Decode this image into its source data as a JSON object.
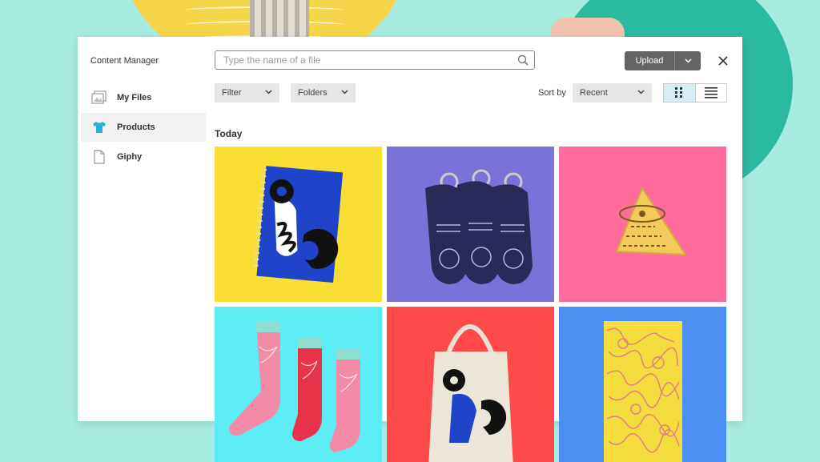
{
  "app": {
    "title": "Content Manager"
  },
  "sidebar": {
    "items": [
      {
        "label": "My Files",
        "icon": "image-stack-icon",
        "active": false
      },
      {
        "label": "Products",
        "icon": "tshirt-icon",
        "active": true
      },
      {
        "label": "Giphy",
        "icon": "document-icon",
        "active": false
      }
    ]
  },
  "search": {
    "placeholder": "Type the name of a file",
    "value": ""
  },
  "toolbar": {
    "upload_label": "Upload",
    "filter_label": "Filter",
    "folders_label": "Folders",
    "sort_label": "Sort by",
    "sort_value": "Recent",
    "view_mode": "grid"
  },
  "content": {
    "section_title": "Today",
    "items": [
      {
        "name": "notebook",
        "color": "#f9df33"
      },
      {
        "name": "keychains",
        "color": "#7a72d9"
      },
      {
        "name": "pin",
        "color": "#ff6b9a"
      },
      {
        "name": "socks",
        "color": "#5cecf4"
      },
      {
        "name": "tote-bag",
        "color": "#ff4a4a"
      },
      {
        "name": "book",
        "color": "#4a8ff1"
      }
    ]
  },
  "colors": {
    "accent": "#2bb9a0",
    "upload_button": "#646464",
    "active_toggle": "#d6eef8"
  }
}
